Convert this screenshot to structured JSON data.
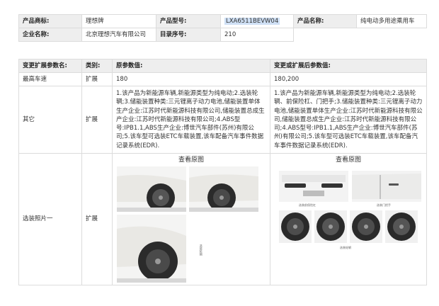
{
  "product_info": {
    "brand_label": "产品商标:",
    "brand": "理想牌",
    "model_label": "产品型号:",
    "model": "LXA6511BEVW04",
    "name_label": "产品名称:",
    "name": "纯电动多用途乘用车",
    "company_label": "企业名称:",
    "company": "北京理想汽车有限公司",
    "catalog_label": "目录序号:",
    "catalog": "210"
  },
  "change_table": {
    "headers": [
      "变更扩展参数名:",
      "类别:",
      "原参数值:",
      "变更或扩展后参数值:"
    ],
    "rows": [
      {
        "param": "最高车速",
        "category": "扩展",
        "original": "180",
        "new": "180,200"
      },
      {
        "param": "其它",
        "category": "扩展",
        "original": "1.该产品为新能源车辆,新能源类型为纯电动;2.选装轮辋;3.储能装置种类:三元锂离子动力电池,储能装置单体生产企业:江苏时代新能源科技有限公司,储能装置总成生产企业:江苏时代新能源科技有限公司;4.ABS型号:IPB1.1,ABS生产企业:博世汽车部件(苏州)有限公司;5.该车型可选装ETC车载装置,该车配备汽车事件数据记录系统(EDR).",
        "new": "1.该产品为新能源车辆,新能源类型为纯电动;2.选装轮辋、前保险杠、门把手;3.储能装置种类:三元锂离子动力电池,储能装置单体生产企业:江苏时代新能源科技有限公司,储能装置总成生产企业:江苏时代新能源科技有限公司;4.ABS型号:IPB1.1,ABS生产企业:博世汽车部件(苏州)有限公司;5.该车型可选装ETC车载装置,该车配备汽车事件数据记录系统(EDR)."
      },
      {
        "param": "选装照片一",
        "category": "扩展",
        "original_photo_title": "查看原图",
        "new_photo_title": "查看原图",
        "original_caption": "选装轮辋",
        "new_captions": [
          "选装前保险杠",
          "选装门把手",
          "选装轮辋"
        ]
      }
    ]
  }
}
